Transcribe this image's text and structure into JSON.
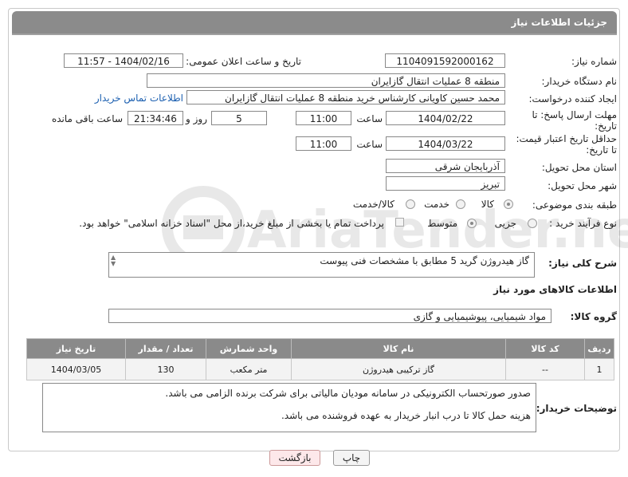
{
  "header": {
    "title": "جزئیات اطلاعات نیاز"
  },
  "fields": {
    "need_number_label": "شماره نیاز:",
    "need_number": "1104091592000162",
    "announce_label": "تاریخ و ساعت اعلان عمومی:",
    "announce_value": "1404/02/16 - 11:57",
    "buyer_org_label": "نام دستگاه خریدار:",
    "buyer_org": "منطقه 8 عملیات انتقال گازایران",
    "requester_label": "ایجاد کننده درخواست:",
    "requester": "محمد حسین کاویانی کارشناس خرید منطقه 8 عملیات انتقال گازایران",
    "contact_link": "اطلاعات تماس خریدار",
    "deadline_label_1": "مهلت ارسال پاسخ: تا",
    "deadline_label_2": "تاریخ:",
    "deadline_date": "1404/02/22",
    "time_label": "ساعت",
    "deadline_time": "11:00",
    "days_value": "5",
    "days_label": "روز و",
    "remaining_value": "21:34:46",
    "remaining_label": "ساعت باقی مانده",
    "price_label_1": "حداقل تاریخ اعتبار قیمت:",
    "price_label_2": "تا تاریخ:",
    "price_date": "1404/03/22",
    "price_time": "11:00",
    "province_label": "استان محل تحویل:",
    "province": "آذربایجان شرقی",
    "city_label": "شهر محل تحویل:",
    "city": "تبریز",
    "category_label": "طبقه بندی موضوعی:",
    "category_options": [
      "کالا",
      "خدمت",
      "کالا/خدمت"
    ],
    "process_label": "نوع فرآیند خرید :",
    "process_options": [
      "جزیی",
      "متوسط"
    ],
    "payment_note": "پرداخت تمام یا بخشی از مبلغ خرید،از محل \"اسناد خزانه اسلامی\" خواهد بود.",
    "description_label": "شرح کلی نیاز:",
    "description": "گاز هیدروژن گرید 5 مطابق با مشخصات فنی پیوست",
    "goods_info_title": "اطلاعات کالاهای مورد نیاز",
    "goods_group_label": "گروه کالا:",
    "goods_group": "مواد شیمیایی، پیوشیمیایی و  گازی",
    "buyer_notes_label": "توضیحات خریدار:",
    "buyer_notes_1": "صدور صورتحساب الکترونیکی در سامانه مودیان مالیاتی برای شرکت برنده الزامی می باشد.",
    "buyer_notes_2": "هزینه حمل کالا تا درب انبار خریدار به عهده فروشنده می باشد."
  },
  "table": {
    "headers": [
      "ردیف",
      "کد کالا",
      "نام کالا",
      "واحد شمارش",
      "تعداد / مقدار",
      "تاریخ نیاز"
    ],
    "rows": [
      [
        "1",
        "--",
        "گاز ترکیبی هیدروژن",
        "متر مکعب",
        "130",
        "1404/03/05"
      ]
    ]
  },
  "buttons": {
    "print": "چاپ",
    "back": "بازگشت"
  },
  "watermark": "AriaTender.neT"
}
